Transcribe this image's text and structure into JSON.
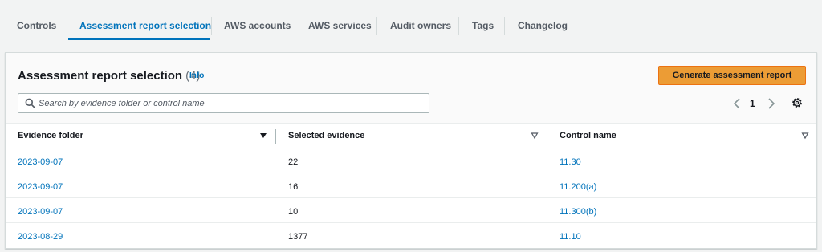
{
  "tabs": [
    {
      "label": "Controls"
    },
    {
      "label": "Assessment report selection"
    },
    {
      "label": "AWS accounts"
    },
    {
      "label": "AWS services"
    },
    {
      "label": "Audit owners"
    },
    {
      "label": "Tags"
    },
    {
      "label": "Changelog"
    }
  ],
  "active_tab": "Assessment report selection",
  "panel": {
    "title": "Assessment report selection",
    "count": "(4)",
    "info_label": "Info",
    "generate_button_label": "Generate assessment report",
    "search_placeholder": "Search by evidence folder or control name",
    "search_value": "",
    "page_number": "1"
  },
  "table": {
    "columns": [
      "Evidence folder",
      "Selected evidence",
      "Control name"
    ],
    "rows": [
      {
        "evidence_folder": "2023-09-07",
        "selected_evidence": "22",
        "control_name": "11.30"
      },
      {
        "evidence_folder": "2023-09-07",
        "selected_evidence": "16",
        "control_name": "11.200(a)"
      },
      {
        "evidence_folder": "2023-09-07",
        "selected_evidence": "10",
        "control_name": "11.300(b)"
      },
      {
        "evidence_folder": "2023-08-29",
        "selected_evidence": "1377",
        "control_name": "11.10"
      }
    ]
  },
  "colors": {
    "link": "#0073bb",
    "primary_button": "#ec9c35",
    "active_tab_underline": "#0073bb"
  }
}
